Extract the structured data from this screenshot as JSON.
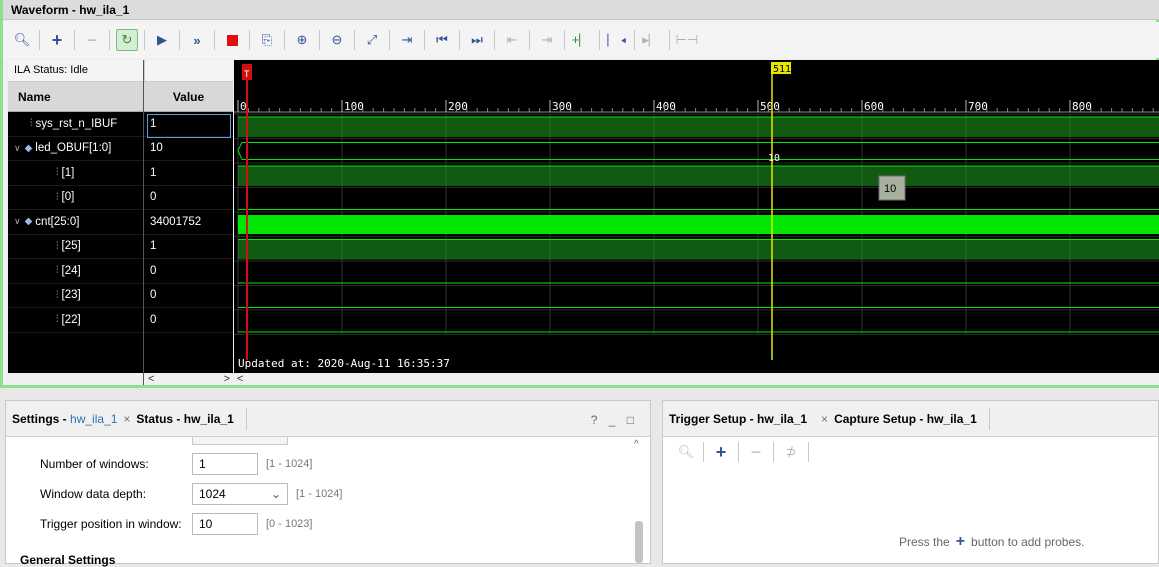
{
  "waveform": {
    "title": "Waveform - hw_ila_1",
    "status": "ILA Status: Idle",
    "col_name": "Name",
    "col_value": "Value",
    "signals": [
      {
        "name": "sys_rst_n_IBUF",
        "value": "1",
        "icon": "signal-icon",
        "level": 0,
        "selected": true
      },
      {
        "name": "led_OBUF[1:0]",
        "value": "10",
        "icon": "bus-icon",
        "level": 0,
        "expanded": true
      },
      {
        "name": "[1]",
        "value": "1",
        "icon": "signal-icon",
        "level": 1
      },
      {
        "name": "[0]",
        "value": "0",
        "icon": "signal-icon",
        "level": 1
      },
      {
        "name": "cnt[25:0]",
        "value": "34001752",
        "icon": "bus-icon",
        "level": 0,
        "expanded": true
      },
      {
        "name": "[25]",
        "value": "1",
        "icon": "signal-icon",
        "level": 1
      },
      {
        "name": "[24]",
        "value": "0",
        "icon": "signal-icon",
        "level": 1
      },
      {
        "name": "[23]",
        "value": "0",
        "icon": "signal-icon",
        "level": 1
      },
      {
        "name": "[22]",
        "value": "0",
        "icon": "signal-icon",
        "level": 1
      }
    ],
    "cursor_label": "511",
    "trigger_marker": "T",
    "ruler_ticks": [
      "0",
      "100",
      "200",
      "300",
      "400",
      "500",
      "600",
      "700",
      "800"
    ],
    "bus_value_label": "10",
    "tooltip": "10",
    "updated_text": "Updated at: 2020-Aug-11 16:35:37",
    "colors": {
      "wave_green": "#1fa41f",
      "wave_bright": "#00e600",
      "cursor": "#e6e600",
      "trigger": "#d01010",
      "panel_border": "#8ee08e"
    },
    "toolbar_icons": [
      "search-icon",
      "add-icon",
      "remove-icon",
      "run-trigger-icon",
      "run-icon",
      "run-immediate-icon",
      "stop-icon",
      "export-icon",
      "zoom-in-icon",
      "zoom-out-icon",
      "zoom-fit-icon",
      "add-marker-icon",
      "go-first-icon",
      "go-last-icon",
      "prev-transition-icon",
      "next-transition-icon",
      "add-marker-2-icon",
      "prev-marker-icon",
      "next-marker-icon",
      "swap-cursor-icon"
    ]
  },
  "settings": {
    "tab_active_prefix": "Settings - ",
    "tab_active_target": "hw_ila_1",
    "tab_close": "×",
    "tab_other": "Status - hw_ila_1",
    "controls": "? _ □",
    "fields": [
      {
        "label": "Number of windows:",
        "value": "1",
        "range": "[1 - 1024]"
      },
      {
        "label": "Window data depth:",
        "value": "1024",
        "range": "[1 - 1024]",
        "dropdown": true
      },
      {
        "label": "Trigger position in window:",
        "value": "10",
        "range": "[0 - 1023]"
      }
    ],
    "section": "General Settings"
  },
  "trigger": {
    "tab_active": "Trigger Setup - hw_ila_1",
    "tab_close": "×",
    "tab_other": "Capture Setup - hw_ila_1",
    "hint_before": "Press the",
    "hint_after": "button to add probes."
  }
}
